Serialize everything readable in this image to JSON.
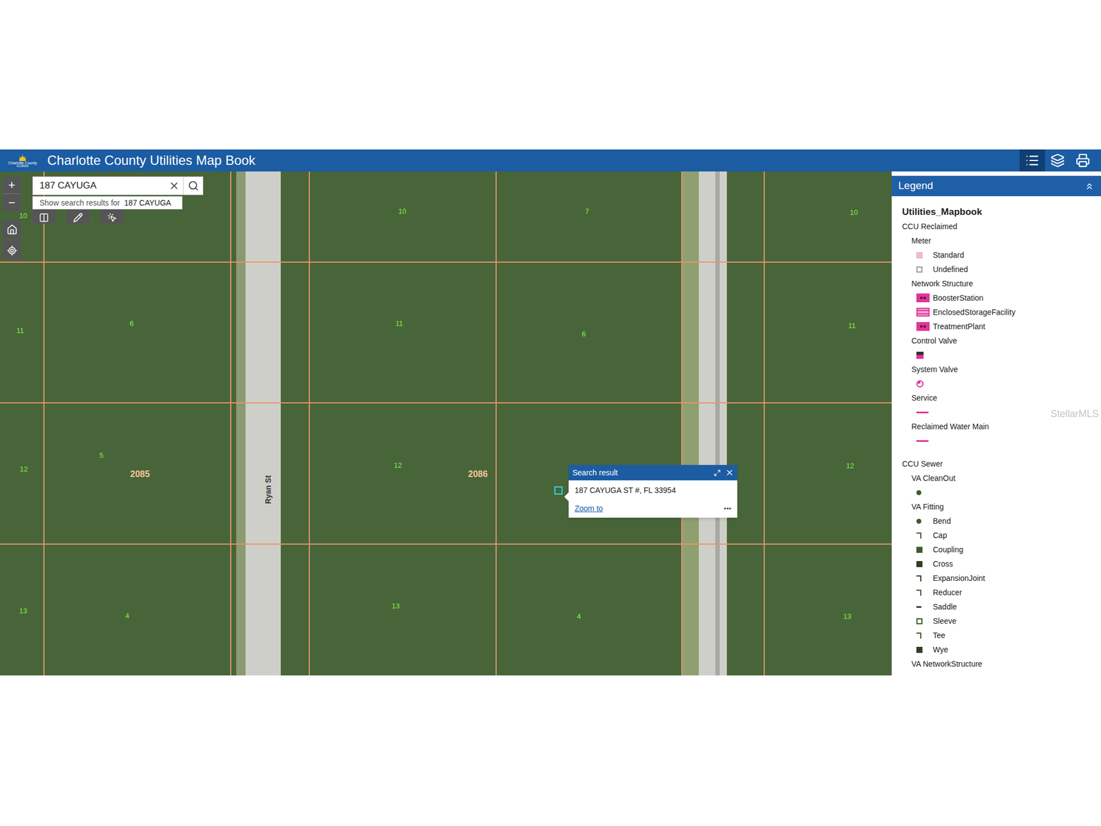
{
  "header": {
    "logo": {
      "name": "Charlotte County",
      "state": "FLORIDA"
    },
    "title": "Charlotte County Utilities Map Book",
    "tools": [
      {
        "name": "legend",
        "selected": true
      },
      {
        "name": "layers",
        "selected": false
      },
      {
        "name": "print",
        "selected": false
      }
    ]
  },
  "search": {
    "value": "187 CAYUGA",
    "suggestion_prefix": "Show search results for ",
    "suggestion_term": "187 CAYUGA"
  },
  "map": {
    "zoom_in": "+",
    "zoom_out": "−",
    "street": "Ryan St",
    "blocks": [
      "2085",
      "2086"
    ],
    "lots": [
      {
        "text": "10"
      },
      {
        "text": "7"
      },
      {
        "text": "10"
      },
      {
        "text": "10"
      },
      {
        "text": "11"
      },
      {
        "text": "6"
      },
      {
        "text": "11"
      },
      {
        "text": "6"
      },
      {
        "text": "11"
      },
      {
        "text": "12"
      },
      {
        "text": "5"
      },
      {
        "text": "12"
      },
      {
        "text": "12"
      },
      {
        "text": "13"
      },
      {
        "text": "4"
      },
      {
        "text": "13"
      },
      {
        "text": "4"
      },
      {
        "text": "13"
      }
    ],
    "popup": {
      "title": "Search result",
      "address": "187 CAYUGA ST #, FL 33954",
      "link": "Zoom to",
      "more": "•••"
    }
  },
  "legend": {
    "title": "Legend",
    "layer": "Utilities_Mapbook",
    "sections": [
      {
        "title": "CCU Reclaimed",
        "groups": [
          {
            "title": "Meter",
            "items": [
              {
                "label": "Standard",
                "kind": "meter",
                "color": "#f4b8d8"
              },
              {
                "label": "Undefined",
                "kind": "box",
                "color": "#9a9a9a"
              }
            ]
          },
          {
            "title": "Network Structure",
            "items": [
              {
                "label": "BoosterStation",
                "kind": "badge",
                "color": "#e0359b"
              },
              {
                "label": "EnclosedStorageFacility",
                "kind": "striped",
                "color": "#e0359b"
              },
              {
                "label": "TreatmentPlant",
                "kind": "badge",
                "color": "#e0359b"
              }
            ]
          },
          {
            "title": "Control Valve",
            "items": [
              {
                "label": "",
                "kind": "split",
                "color": "#e0359b"
              }
            ]
          },
          {
            "title": "System Valve",
            "items": [
              {
                "label": "",
                "kind": "circle",
                "color": "#e0359b"
              }
            ]
          },
          {
            "title": "Service",
            "items": [
              {
                "label": "",
                "kind": "line",
                "color": "#e0359b"
              }
            ]
          },
          {
            "title": "Reclaimed Water Main",
            "items": [
              {
                "label": "",
                "kind": "line",
                "color": "#e0359b"
              }
            ]
          }
        ]
      },
      {
        "title": "CCU Sewer",
        "groups": [
          {
            "title": "VA CleanOut",
            "items": [
              {
                "label": "",
                "kind": "dot",
                "color": "#3e5a2e"
              }
            ]
          },
          {
            "title": "VA Fitting",
            "items": [
              {
                "label": "Bend",
                "kind": "dot",
                "color": "#3e5a2e"
              },
              {
                "label": "Cap",
                "kind": "glyph",
                "color": "#3e5a2e"
              },
              {
                "label": "Coupling",
                "kind": "square",
                "color": "#3e5a2e"
              },
              {
                "label": "Cross",
                "kind": "square",
                "color": "#2f3f24"
              },
              {
                "label": "ExpansionJoint",
                "kind": "glyph",
                "color": "#2f3f24"
              },
              {
                "label": "Reducer",
                "kind": "glyph",
                "color": "#3e5a2e"
              },
              {
                "label": "Saddle",
                "kind": "dash",
                "color": "#2f3f24"
              },
              {
                "label": "Sleeve",
                "kind": "box",
                "color": "#3e5a2e"
              },
              {
                "label": "Tee",
                "kind": "glyph",
                "color": "#3e5a2e"
              },
              {
                "label": "Wye",
                "kind": "square",
                "color": "#2f3f24"
              }
            ]
          },
          {
            "title": "VA NetworkStructure",
            "items": []
          }
        ]
      }
    ]
  },
  "watermark": "StellarMLS"
}
